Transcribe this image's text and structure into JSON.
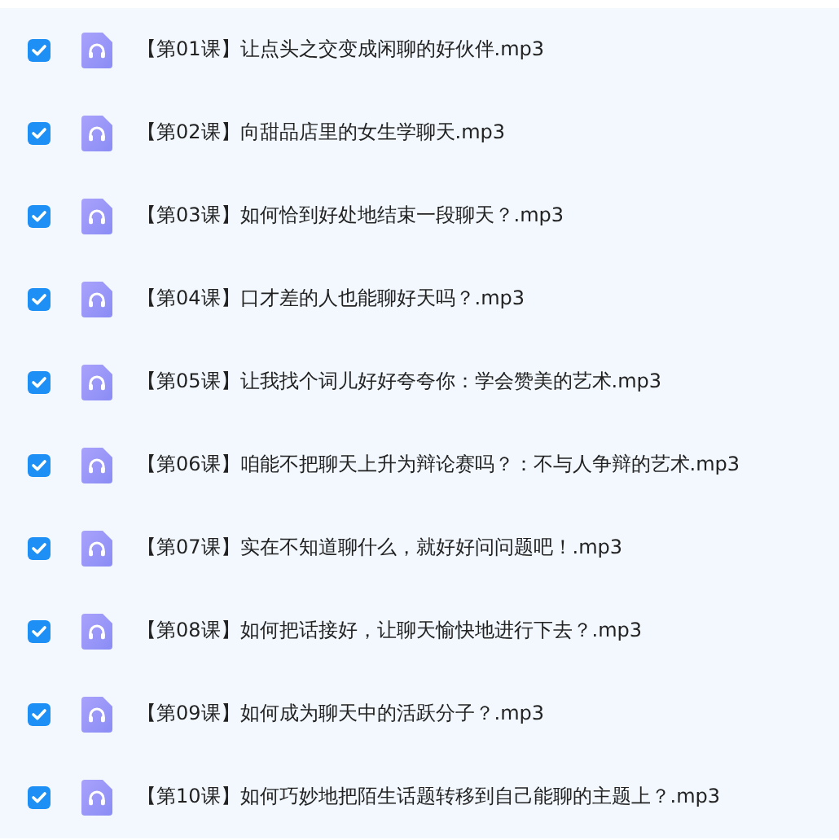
{
  "files": [
    {
      "name": "【第01课】让点头之交变成闲聊的好伙伴.mp3",
      "checked": true
    },
    {
      "name": "【第02课】向甜品店里的女生学聊天.mp3",
      "checked": true
    },
    {
      "name": "【第03课】如何恰到好处地结束一段聊天？.mp3",
      "checked": true
    },
    {
      "name": "【第04课】口才差的人也能聊好天吗？.mp3",
      "checked": true
    },
    {
      "name": "【第05课】让我找个词儿好好夸夸你：学会赞美的艺术.mp3",
      "checked": true
    },
    {
      "name": "【第06课】咱能不把聊天上升为辩论赛吗？：不与人争辩的艺术.mp3",
      "checked": true
    },
    {
      "name": "【第07课】实在不知道聊什么，就好好问问题吧！.mp3",
      "checked": true
    },
    {
      "name": "【第08课】如何把话接好，让聊天愉快地进行下去？.mp3",
      "checked": true
    },
    {
      "name": "【第09课】如何成为聊天中的活跃分子？.mp3",
      "checked": true
    },
    {
      "name": "【第10课】如何巧妙地把陌生话题转移到自己能聊的主题上？.mp3",
      "checked": true
    }
  ]
}
